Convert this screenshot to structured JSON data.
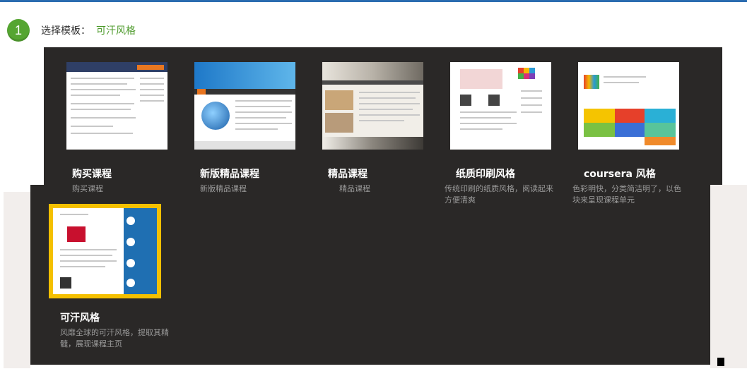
{
  "step": {
    "number": "1",
    "label": "选择模板：",
    "value": "可汗风格"
  },
  "templates": [
    {
      "title": "购买课程",
      "desc": "购买课程"
    },
    {
      "title": "新版精品课程",
      "desc": "新版精品课程"
    },
    {
      "title": "精品课程",
      "desc": "精品课程"
    },
    {
      "title": "纸质印刷风格",
      "desc": "传统印刷的纸质风格，阅读起来方便清爽"
    },
    {
      "title": "coursera 风格",
      "desc": "色彩明快，分类简洁明了，以色块来呈现课程单元"
    },
    {
      "title": "可汗风格",
      "desc": "风靡全球的可汗风格，提取其精髓，展现课程主页"
    }
  ],
  "colors": {
    "accent_green": "#55a531",
    "selected_border": "#f4c000",
    "panel_bg": "#2a2827"
  }
}
